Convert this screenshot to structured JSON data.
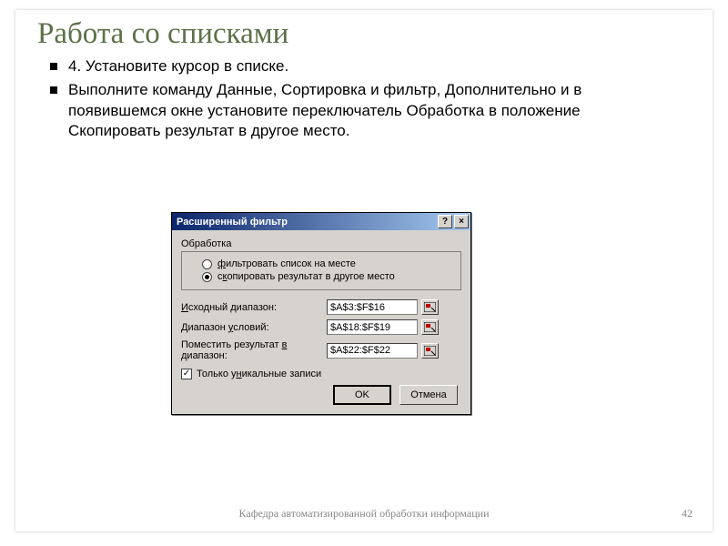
{
  "slide": {
    "title": "Работа со списками",
    "bullets": [
      "4. Установите курсор в списке.",
      "Выполните команду  Данные, Сортировка и фильтр, Дополнительно и в появившемся окне  установите переключатель Обработка в положение Скопировать результат в другое место."
    ],
    "footer": "Кафедра автоматизированной обработки информации",
    "page": "42"
  },
  "dialog": {
    "title": "Расширенный фильтр",
    "help_btn": "?",
    "close_btn": "×",
    "group_label": "Обработка",
    "radio1_pre": "",
    "radio1_u": "ф",
    "radio1_post": "ильтровать список на месте",
    "radio2_pre": "с",
    "radio2_u": "к",
    "radio2_post": "опировать результат в другое место",
    "row1_pre": "",
    "row1_u": "И",
    "row1_post": "сходный диапазон:",
    "row1_value": "$A$3:$F$16",
    "row2_pre": "Диапазон ",
    "row2_u": "у",
    "row2_post": "словий:",
    "row2_value": "$A$18:$F$19",
    "row3_pre": "Поместить результат ",
    "row3_u": "в",
    "row3_post": " диапазон:",
    "row3_value": "$A$22:$F$22",
    "chk_pre": "Только у",
    "chk_u": "н",
    "chk_post": "икальные записи",
    "chk_checked": "✓",
    "ok": "OK",
    "cancel": "Отмена"
  }
}
